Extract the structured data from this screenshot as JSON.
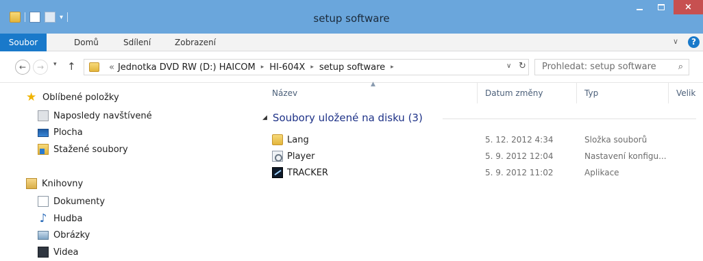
{
  "window": {
    "title": "setup software",
    "close_glyph": "×"
  },
  "ribbon": {
    "tabs": [
      {
        "label": "Soubor"
      },
      {
        "label": "Domů"
      },
      {
        "label": "Sdílení"
      },
      {
        "label": "Zobrazení"
      }
    ],
    "help_glyph": "?",
    "collapse_glyph": "∨"
  },
  "address": {
    "lead": "«",
    "crumbs": [
      "Jednotka DVD RW (D:) HAICOM",
      "HI-604X",
      "setup software"
    ],
    "sep": "▸"
  },
  "search": {
    "placeholder": "Prohledat: setup software"
  },
  "nav": {
    "back_glyph": "←",
    "forward_glyph": "→",
    "up_glyph": "↑",
    "recent_glyph": "▾",
    "dropdown_glyph": "∨",
    "refresh_glyph": "↻"
  },
  "sidebar": {
    "favorites": {
      "label": "Oblíbené položky",
      "items": [
        {
          "label": "Naposledy navštívené",
          "icon": "recent-places-icon"
        },
        {
          "label": "Plocha",
          "icon": "desktop-icon"
        },
        {
          "label": "Stažené soubory",
          "icon": "downloads-icon"
        }
      ]
    },
    "libraries": {
      "label": "Knihovny",
      "items": [
        {
          "label": "Dokumenty",
          "icon": "documents-icon"
        },
        {
          "label": "Hudba",
          "icon": "music-icon"
        },
        {
          "label": "Obrázky",
          "icon": "pictures-icon"
        },
        {
          "label": "Videa",
          "icon": "videos-icon"
        }
      ]
    }
  },
  "columns": {
    "name": "Název",
    "date": "Datum změny",
    "type": "Typ",
    "size": "Velik"
  },
  "group": {
    "label": "Soubory uložené na disku (3)",
    "expand_glyph": "◢"
  },
  "files": [
    {
      "name": "Lang",
      "date": "5. 12. 2012 4:34",
      "type": "Složka souborů",
      "icon": "folder-icon"
    },
    {
      "name": "Player",
      "date": "5. 9. 2012 12:04",
      "type": "Nastavení konfigu...",
      "icon": "config-file-icon"
    },
    {
      "name": "TRACKER",
      "date": "5. 9. 2012 11:02",
      "type": "Aplikace",
      "icon": "application-icon"
    }
  ],
  "colors": {
    "titlebar": "#6aa6dc",
    "file_tab": "#1979ca",
    "close_button": "#c75050",
    "group_heading": "#1e3287"
  }
}
